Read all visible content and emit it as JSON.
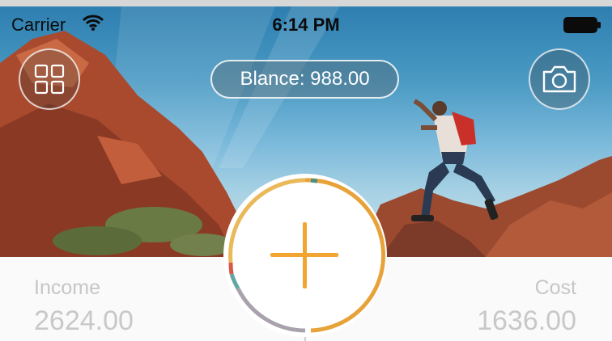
{
  "status_bar": {
    "carrier": "Carrier",
    "time": "6:14 PM"
  },
  "header": {
    "balance_text": "Blance: 988.00"
  },
  "summary": {
    "income_label": "Income",
    "income_value": "2624.00",
    "cost_label": "Cost",
    "cost_value": "1636.00"
  },
  "icons": {
    "menu": "grid-icon",
    "camera": "camera-icon",
    "add": "plus-icon",
    "wifi": "wifi-icon",
    "battery": "battery-icon"
  },
  "colors": {
    "accent": "#f2a530",
    "ring_orange": "#e8a23a",
    "ring_gray": "#a9a2ad",
    "ring_teal": "#5fa8a0",
    "ring_red": "#d9584a",
    "label_gray": "#c6c6c6"
  }
}
